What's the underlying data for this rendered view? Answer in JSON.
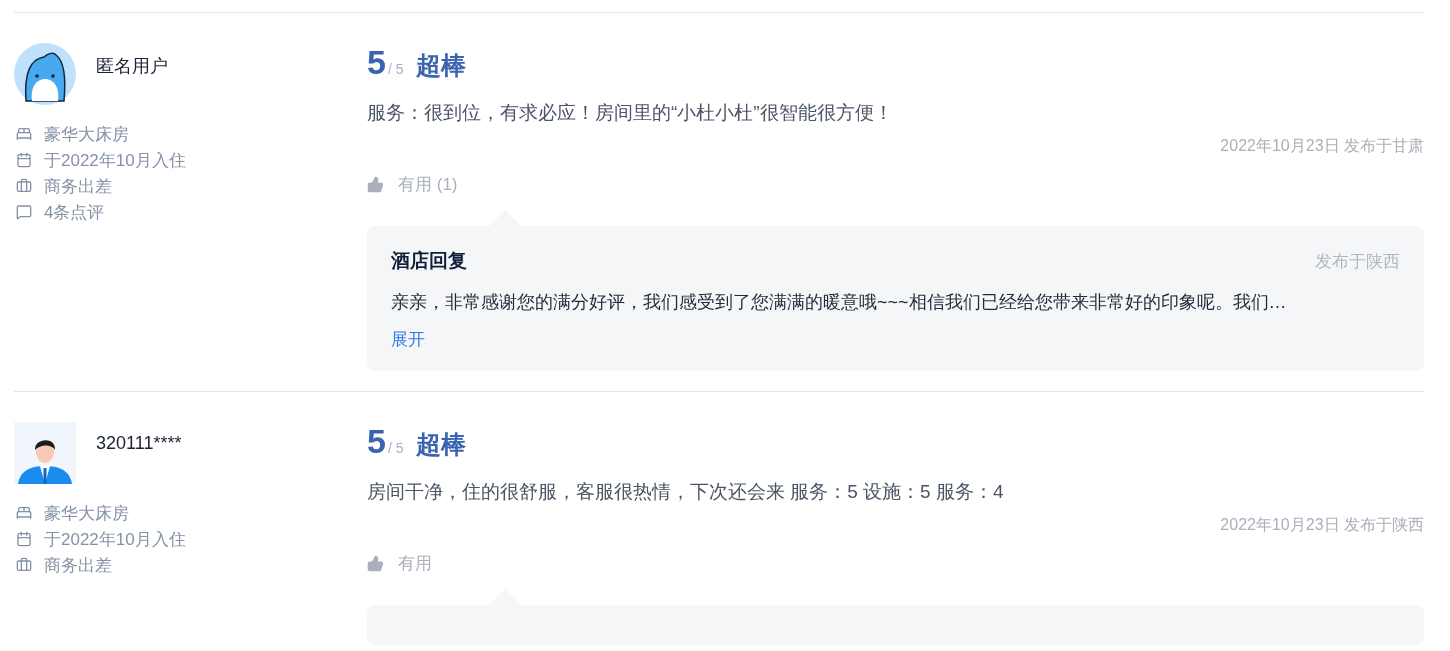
{
  "reviews": [
    {
      "user": {
        "name": "匿名用户",
        "avatar": {
          "kind": "dolphin"
        },
        "info": [
          {
            "kind": "room",
            "text": "豪华大床房"
          },
          {
            "kind": "date",
            "text": "于2022年10月入住"
          },
          {
            "kind": "trip",
            "text": "商务出差"
          },
          {
            "kind": "count",
            "text": "4条点评"
          }
        ]
      },
      "score": "5",
      "scale": "/ 5",
      "verdict": "超棒",
      "text": "服务：很到位，有求必应！房间里的“小杜小杜”很智能很方便！",
      "meta": "2022年10月23日 发布于甘肃",
      "useful": "有用 (1)",
      "reply": {
        "kind": "full",
        "title": "酒店回复",
        "location": "发布于陕西",
        "text": "亲亲，非常感谢您的满分好评，我们感受到了您满满的暖意哦~~~相信我们已经给您带来非常好的印象呢。我们…",
        "more": "展开"
      }
    },
    {
      "user": {
        "name": "320111****",
        "avatar": {
          "kind": "person"
        },
        "info": [
          {
            "kind": "room",
            "text": "豪华大床房"
          },
          {
            "kind": "date",
            "text": "于2022年10月入住"
          },
          {
            "kind": "trip",
            "text": "商务出差"
          }
        ]
      },
      "score": "5",
      "scale": "/ 5",
      "verdict": "超棒",
      "text": "房间干净，住的很舒服，客服很热情，下次还会来 服务：5 设施：5 服务：4",
      "meta": "2022年10月23日 发布于陕西",
      "useful": "有用",
      "reply": {
        "kind": "cut"
      }
    }
  ]
}
